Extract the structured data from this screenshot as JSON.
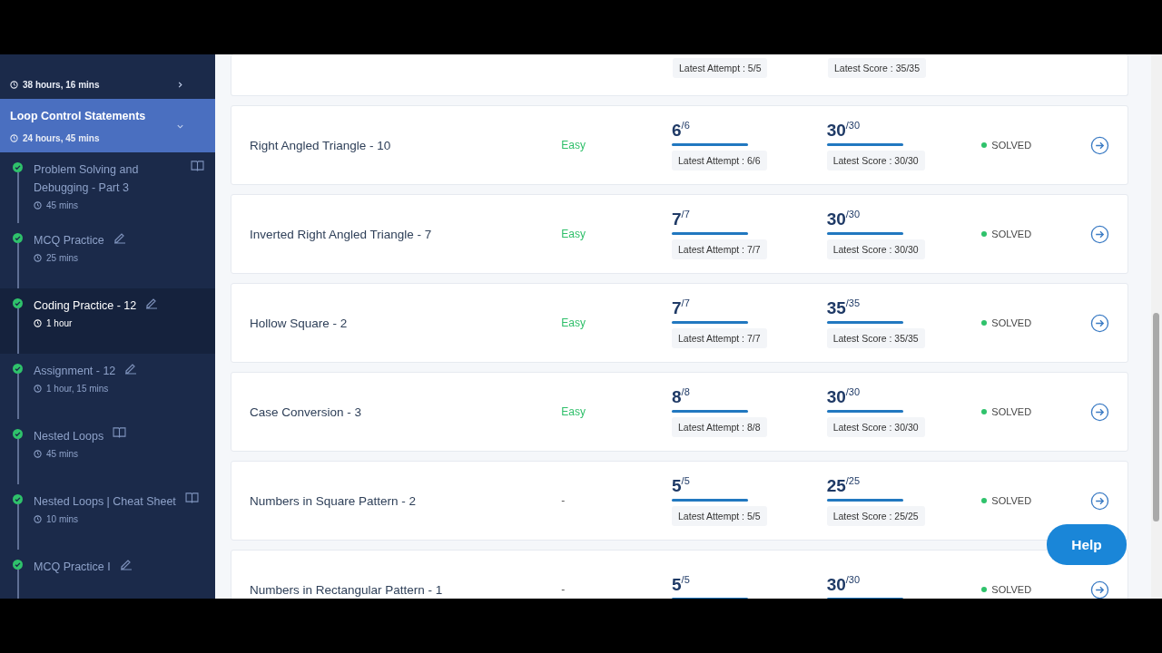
{
  "sidebar": {
    "sections": [
      {
        "duration": "38 hours, 16 mins",
        "expanded": false,
        "selected": false
      },
      {
        "title": "Loop Control Statements",
        "duration": "24 hours, 45 mins",
        "expanded": true,
        "selected": true,
        "items": [
          {
            "title": "Problem Solving and Debugging - Part 3",
            "kind": "reading",
            "duration": "45 mins",
            "completed": true,
            "selected": false
          },
          {
            "title": "MCQ Practice",
            "kind": "practice",
            "duration": "25 mins",
            "completed": true,
            "selected": false
          },
          {
            "title": "Coding Practice - 12",
            "kind": "practice",
            "duration": "1 hour",
            "completed": true,
            "selected": true
          },
          {
            "title": "Assignment - 12",
            "kind": "practice",
            "duration": "1 hour, 15 mins",
            "completed": true,
            "selected": false
          },
          {
            "title": "Nested Loops",
            "kind": "reading",
            "duration": "45 mins",
            "completed": true,
            "selected": false
          },
          {
            "title": "Nested Loops | Cheat Sheet",
            "kind": "reading",
            "duration": "10 mins",
            "completed": true,
            "selected": false
          },
          {
            "title": "MCQ Practice I",
            "kind": "practice",
            "completed": true,
            "selected": false
          }
        ]
      }
    ]
  },
  "problems": [
    {
      "attempt_note": "Latest Attempt : 5/5",
      "score_note": "Latest Score : 35/35"
    },
    {
      "name": "Right Angled Triangle - 10",
      "difficulty": "Easy",
      "attempts": "6",
      "attempts_total": "/6",
      "attempts_bar": {
        "level": 1
      },
      "attempt_note": "Latest Attempt : 6/6",
      "score": "30",
      "score_total": "/30",
      "score_bar": {
        "level": 1
      },
      "score_note": "Latest Score : 30/30",
      "status": "SOLVED"
    },
    {
      "name": "Inverted Right Angled Triangle - 7",
      "difficulty": "Easy",
      "attempts": "7",
      "attempts_total": "/7",
      "attempts_bar": {
        "level": 1
      },
      "attempt_note": "Latest Attempt : 7/7",
      "score": "30",
      "score_total": "/30",
      "score_bar": {
        "level": 1
      },
      "score_note": "Latest Score : 30/30",
      "status": "SOLVED"
    },
    {
      "name": "Hollow Square - 2",
      "difficulty": "Easy",
      "attempts": "7",
      "attempts_total": "/7",
      "attempts_bar": {
        "level": 1
      },
      "attempt_note": "Latest Attempt : 7/7",
      "score": "35",
      "score_total": "/35",
      "score_bar": {
        "level": 1
      },
      "score_note": "Latest Score : 35/35",
      "status": "SOLVED"
    },
    {
      "name": "Case Conversion - 3",
      "difficulty": "Easy",
      "attempts": "8",
      "attempts_total": "/8",
      "attempts_bar": {
        "level": 1
      },
      "attempt_note": "Latest Attempt : 8/8",
      "score": "30",
      "score_total": "/30",
      "score_bar": {
        "level": 1
      },
      "score_note": "Latest Score : 30/30",
      "status": "SOLVED"
    },
    {
      "name": "Numbers in Square Pattern - 2",
      "difficulty": "-",
      "attempts": "5",
      "attempts_total": "/5",
      "attempts_bar": {
        "level": 1
      },
      "attempt_note": "Latest Attempt : 5/5",
      "score": "25",
      "score_total": "/25",
      "score_bar": {
        "level": 1
      },
      "score_note": "Latest Score : 25/25",
      "status": "SOLVED"
    },
    {
      "name": "Numbers in Rectangular Pattern - 1",
      "difficulty": "-",
      "attempts": "5",
      "attempts_total": "/5",
      "attempts_bar": {
        "level": 1
      },
      "score": "30",
      "score_total": "/30",
      "score_bar": {
        "level": 1
      },
      "status": "SOLVED"
    }
  ],
  "help_button": "Help"
}
